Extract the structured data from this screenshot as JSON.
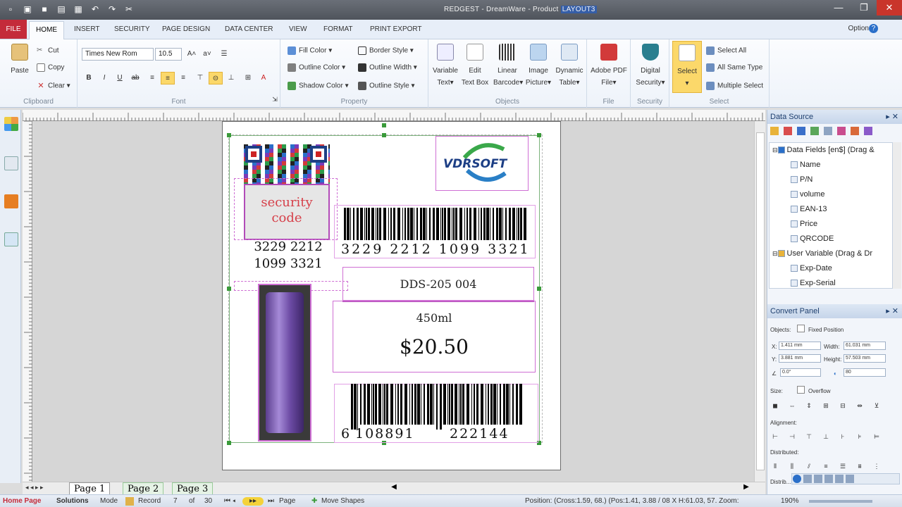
{
  "titlebar": {
    "title": "REDGEST - DreamWare - Product",
    "doc_highlight": "LAYOUT3"
  },
  "tabs": {
    "file": "FILE",
    "items": [
      "HOME",
      "INSERT",
      "SECURITY",
      "PAGE DESIGN",
      "DATA CENTER",
      "VIEW",
      "FORMAT",
      "PRINT EXPORT"
    ],
    "options": "Options"
  },
  "ribbon": {
    "clipboard": {
      "paste": "Paste",
      "cut": "Cut",
      "copy": "Copy",
      "clear": "Clear",
      "label": "Clipboard"
    },
    "font": {
      "family": "Times New Rom",
      "size": "10.5",
      "label": "Font"
    },
    "property": {
      "fill_color": "Fill Color",
      "outline_color": "Outline Color",
      "shadow_color": "Shadow Color",
      "border_style": "Border Style",
      "outline_width": "Outline Width",
      "outline_style": "Outline Style",
      "label": "Property"
    },
    "objects": {
      "variable_text": [
        "Variable",
        "Text"
      ],
      "edit_text_box": [
        "Edit",
        "Text Box"
      ],
      "linear_barcode": [
        "Linear",
        "Barcode"
      ],
      "image_picture": [
        "Image",
        "Picture"
      ],
      "dynamic_table": [
        "Dynamic",
        "Table"
      ],
      "label": "Objects"
    },
    "file": {
      "adobe_pdf": [
        "Adobe PDF",
        "File"
      ],
      "label": "File"
    },
    "security": {
      "digital": [
        "Digital",
        "Security"
      ],
      "label": "Security"
    },
    "select": {
      "select": "Select",
      "select_all": "Select All",
      "all_same_type": "All Same Type",
      "multiple_select": "Multiple Select",
      "label": "Select"
    }
  },
  "label": {
    "security_code": [
      "security",
      "code"
    ],
    "qr_number": [
      "3229 2212",
      "1099 3321"
    ],
    "barcode1_text": "3229 2212 1099 3321",
    "logo": "VDRSOFT",
    "model": "DDS-205 004",
    "volume": "450ml",
    "price": "$20.50",
    "ean_left": "6",
    "ean_mid": "108891",
    "ean_right": "222144"
  },
  "pages": [
    "Page 1",
    "Page 2",
    "Page 3"
  ],
  "status": {
    "home_page": "Home Page",
    "solutions": "Solutions",
    "mode": "Mode",
    "record": "Record",
    "record_value": "7",
    "of": "of",
    "total": "30",
    "page": "Page",
    "move_shapes": "Move Shapes",
    "position": "Position: (Cross:1.59, 68.) (Pos:1.41, 3.88 / 08 X H:61.03, 57. Zoom:",
    "zoom": "190%"
  },
  "data_source": {
    "title": "Data Source",
    "fields_root": "Data Fields [en$] (Drag &",
    "fields": [
      "Name",
      "P/N",
      "volume",
      "EAN-13",
      "Price",
      "QRCODE"
    ],
    "variables_root": "User Variable (Drag & Dr",
    "variables": [
      "Exp-Date",
      "Exp-Serial"
    ]
  },
  "convert_panel": {
    "title": "Convert Panel",
    "objects_label": "Objects:",
    "fixed_position": "Fixed Position",
    "x_label": "X:",
    "x_value": "1.411 mm",
    "width_label": "Width:",
    "width_value": "61.031 mm",
    "y_label": "Y:",
    "y_value": "3.881 mm",
    "height_label": "Height:",
    "height_value": "57.503 mm",
    "angle_value": "0.0°",
    "pct_value": "80",
    "size_label": "Size:",
    "overflow": "Overflow",
    "alignment_label": "Alignment:",
    "distributed_label": "Distributed:",
    "distrib_label2": "Distrib..."
  },
  "colors": {
    "accent": "#c42b3a",
    "ribbon": "#e7eef8",
    "select": "#fbd86a",
    "outline": "#cf6fd4"
  }
}
